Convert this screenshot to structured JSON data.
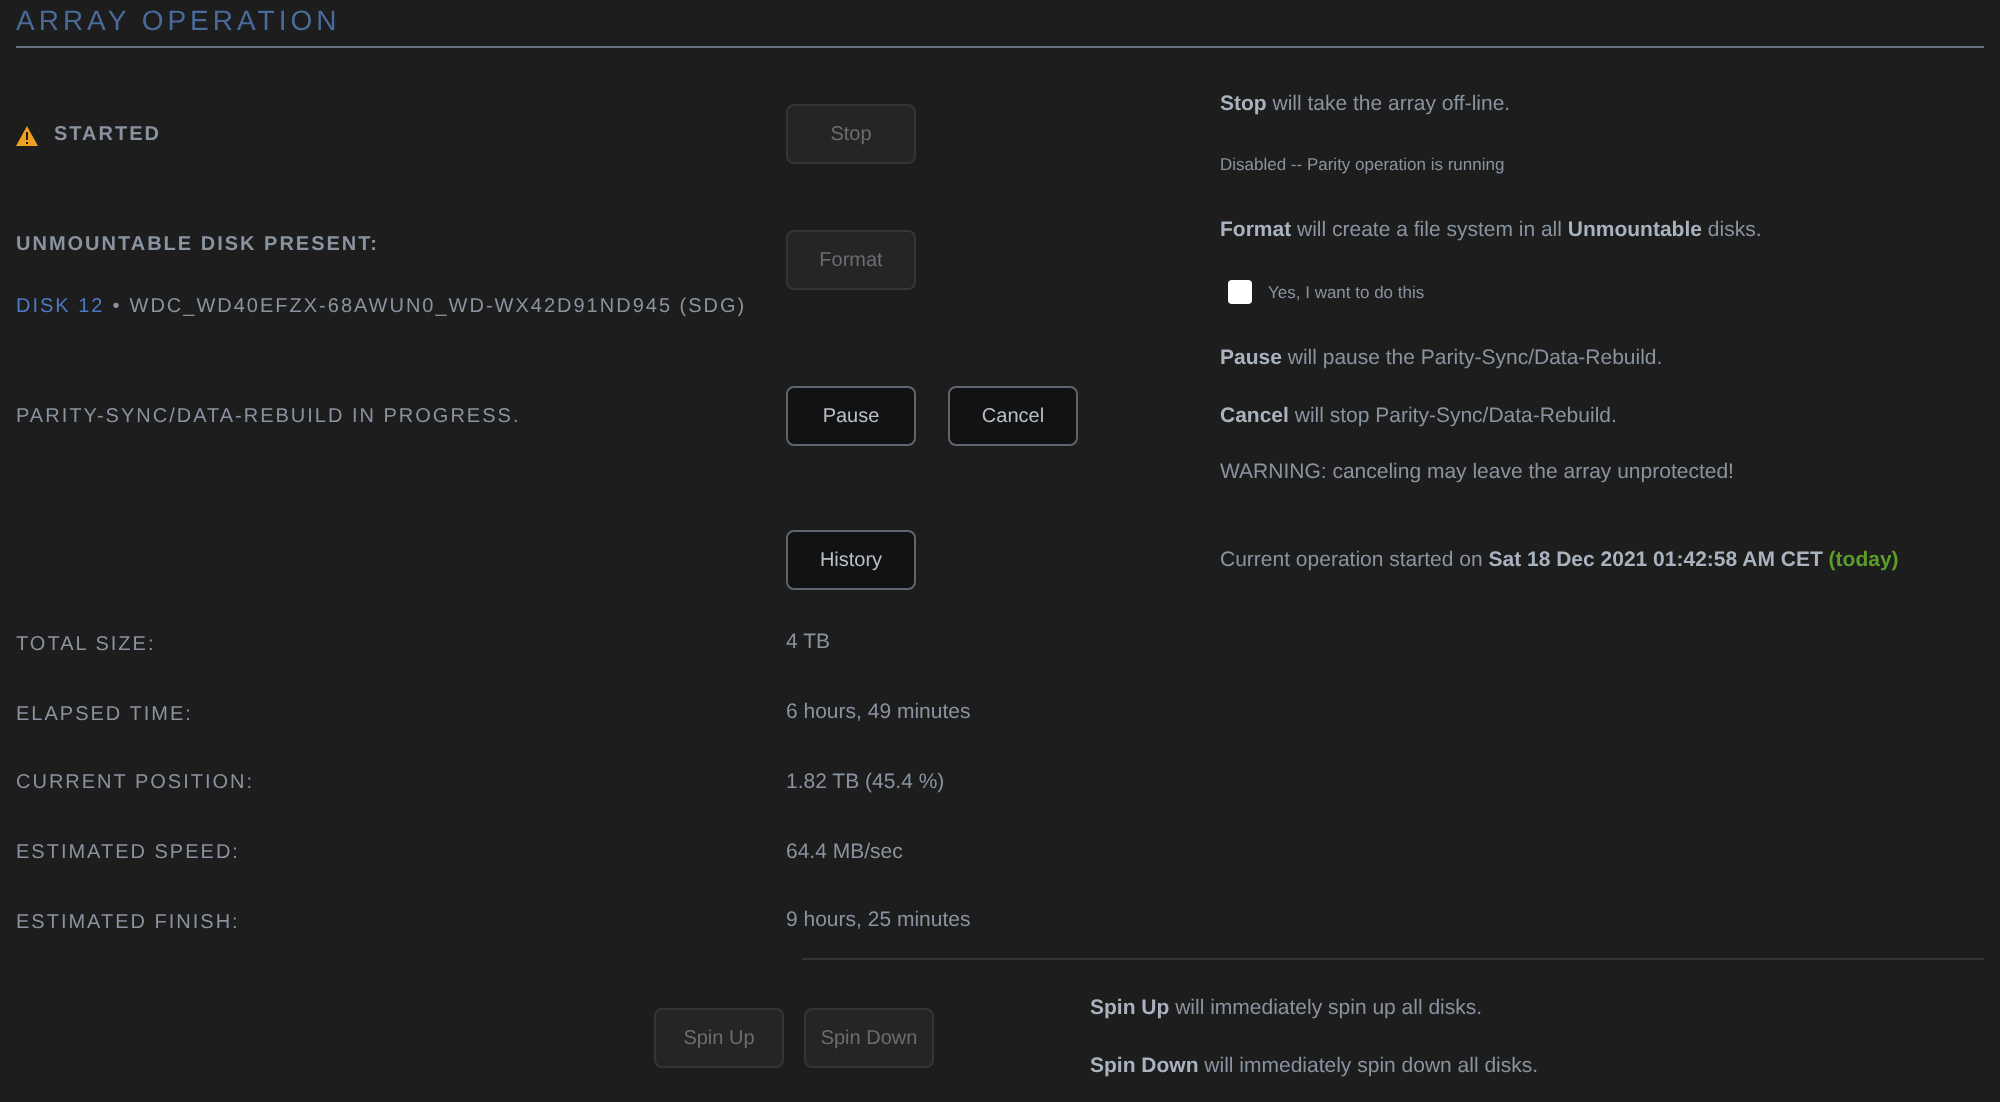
{
  "title": "ARRAY OPERATION",
  "sections": [
    {
      "lines": [
        {
          "text": "STARTED",
          "kind": "warning"
        }
      ],
      "buttons": [
        {
          "label": "Stop",
          "disabled": true
        }
      ],
      "notes": [
        {
          "text": "**Stop** will take the array off-line.",
          "kind": "text"
        },
        {
          "text": "Disabled -- Parity operation is running",
          "kind": "small"
        }
      ]
    },
    {
      "lines": [
        {
          "text": "UNMOUNTABLE DISK PRESENT:",
          "kind": "heading"
        },
        {
          "text": "WDC_WD40EFZX-68AWUN0_WD-WX42D91ND945 (SDG)",
          "disk": "DISK 12",
          "separator": "•",
          "kind": "disk"
        }
      ],
      "buttons": [
        {
          "label": "Format",
          "disabled": true
        }
      ],
      "notes": [
        {
          "text": "**Format** will create a file system in all **Unmountable** disks.",
          "kind": "text"
        },
        {
          "text": "Yes, I want to do this",
          "kind": "checkbox",
          "checked": false
        }
      ]
    },
    {
      "lines": [
        {
          "text": "PARITY-SYNC/DATA-REBUILD IN PROGRESS.",
          "kind": "plain"
        }
      ],
      "buttons": [
        {
          "label": "Pause",
          "disabled": false
        },
        {
          "label": "Cancel",
          "disabled": false
        }
      ],
      "notes": [
        {
          "text": "**Pause** will pause the Parity-Sync/Data-Rebuild.",
          "kind": "text"
        },
        {
          "text": "**Cancel** will stop Parity-Sync/Data-Rebuild.",
          "kind": "text"
        },
        {
          "text": "WARNING: canceling may leave the array unprotected!",
          "kind": "text"
        }
      ]
    },
    {
      "buttons": [
        {
          "label": "History",
          "disabled": false
        }
      ],
      "notes": [
        {
          "text": "Current operation started on **Sat 18 Dec 2021 01:42:58 AM CET**",
          "note": "(today)",
          "kind": "started"
        }
      ]
    }
  ],
  "stats": [
    {
      "label": "TOTAL SIZE:",
      "value": "4 TB"
    },
    {
      "label": "ELAPSED TIME:",
      "value": "6 hours, 49 minutes"
    },
    {
      "label": "CURRENT POSITION:",
      "value": "1.82 TB (45.4 %)"
    },
    {
      "label": "ESTIMATED SPEED:",
      "value": "64.4 MB/sec"
    },
    {
      "label": "ESTIMATED FINISH:",
      "value": "9 hours, 25 minutes"
    }
  ],
  "spin": {
    "buttons": [
      {
        "label": "Spin Up",
        "disabled": true
      },
      {
        "label": "Spin Down",
        "disabled": true
      }
    ],
    "notes": [
      "**Spin Up** will immediately spin up all disks.",
      "**Spin Down** will immediately spin down all disks."
    ]
  }
}
